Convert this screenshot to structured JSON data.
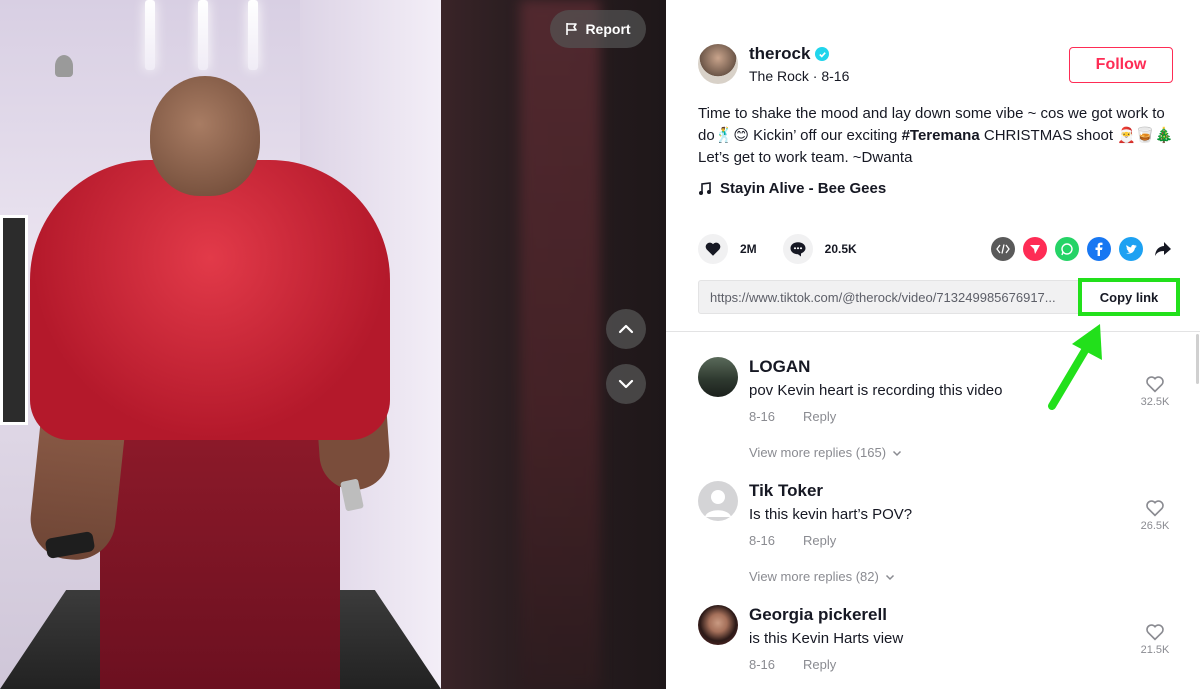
{
  "player": {
    "report_label": "Report"
  },
  "author": {
    "username": "therock",
    "display_name_date": "The Rock · 8-16",
    "follow_label": "Follow"
  },
  "caption": {
    "line1": "Time to shake the mood and lay down some vibe ~ cos we got work to do🕺😊 Kickin’ off our exciting ",
    "hashtag": "#Teremana",
    "line2": " CHRISTMAS shoot 🎅🥃🎄 Let’s get to work team. ~Dwanta"
  },
  "music": {
    "title": "Stayin Alive - Bee Gees"
  },
  "stats": {
    "likes": "2M",
    "comments": "20.5K"
  },
  "share": {
    "icons": [
      "embed-icon",
      "send-icon",
      "whatsapp-icon",
      "facebook-icon",
      "twitter-icon",
      "share-arrow-icon"
    ],
    "colors": {
      "embed": "#5a5a5a",
      "send": "#fe2c55",
      "whatsapp": "#25d366",
      "facebook": "#1877f2",
      "twitter": "#1da1f2"
    }
  },
  "link": {
    "url": "https://www.tiktok.com/@therock/video/713249985676917...",
    "copy_label": "Copy link"
  },
  "comments": [
    {
      "name": "LOGAN",
      "text": "pov Kevin heart is recording this video",
      "date": "8-16",
      "reply": "Reply",
      "likes": "32.5K",
      "view_more": "View more replies (165)"
    },
    {
      "name": "Tik Toker",
      "text": "Is this kevin hart’s POV?",
      "date": "8-16",
      "reply": "Reply",
      "likes": "26.5K",
      "view_more": "View more replies (82)"
    },
    {
      "name": "Georgia pickerell",
      "text": "is this Kevin Harts view",
      "date": "8-16",
      "reply": "Reply",
      "likes": "21.5K"
    }
  ],
  "colors": {
    "accent": "#fe2c55",
    "annotation": "#22e01b",
    "verified": "#20d5ec"
  }
}
